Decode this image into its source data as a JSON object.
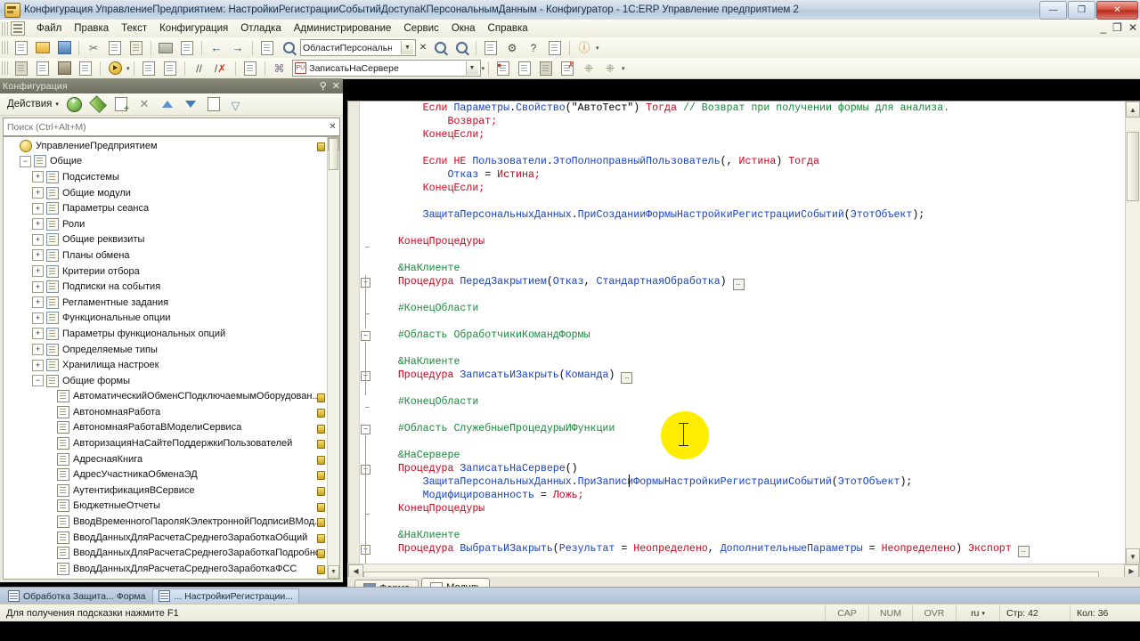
{
  "window": {
    "title": "Конфигурация УправлениеПредприятием: НастройкиРегистрацииСобытийДоступаКПерсональнымДанным - Конфигуратор - 1C:ERP Управление предприятием 2",
    "minimize": "—",
    "restore": "❐",
    "close": "✕",
    "inner_minimize": "_",
    "inner_restore": "❐",
    "inner_close": "✕"
  },
  "menu": {
    "items": [
      {
        "label": "Файл"
      },
      {
        "label": "Правка"
      },
      {
        "label": "Текст"
      },
      {
        "label": "Конфигурация"
      },
      {
        "label": "Отладка"
      },
      {
        "label": "Администрирование"
      },
      {
        "label": "Сервис"
      },
      {
        "label": "Окна"
      },
      {
        "label": "Справка"
      }
    ]
  },
  "toolbar_main": {
    "combo_value": "ОбластиПерсональныхДанных",
    "clear_label": "✕",
    "arrow_label": "▼"
  },
  "toolbar_second": {
    "proc_badge": "PU",
    "proc_value": "ЗаписатьНаСервере",
    "arrow_label": "▼"
  },
  "left_panel": {
    "caption": "Конфигурация",
    "pin_icon": "⚲",
    "close_icon": "✕",
    "actions_label": "Действия",
    "actions_caret": "▾",
    "search_placeholder": "Поиск (Ctrl+Alt+M)",
    "search_value": "",
    "search_clear": "✕",
    "tree": [
      {
        "label": "УправлениеПредприятием",
        "indent": 0,
        "expander": "",
        "icon": "yellow-ball-icon",
        "dot": true
      },
      {
        "label": "Общие",
        "indent": 1,
        "expander": "−",
        "icon": "common-icon",
        "dot": false
      },
      {
        "label": "Подсистемы",
        "indent": 2,
        "expander": "+",
        "icon": "subsystems-icon",
        "dot": false
      },
      {
        "label": "Общие модули",
        "indent": 2,
        "expander": "+",
        "icon": "module-icon",
        "dot": false
      },
      {
        "label": "Параметры сеанса",
        "indent": 2,
        "expander": "+",
        "icon": "diamond-icon",
        "dot": false
      },
      {
        "label": "Роли",
        "indent": 2,
        "expander": "+",
        "icon": "key-icon",
        "dot": false
      },
      {
        "label": "Общие реквизиты",
        "indent": 2,
        "expander": "+",
        "icon": "attribute-icon",
        "dot": false
      },
      {
        "label": "Планы обмена",
        "indent": 2,
        "expander": "+",
        "icon": "exchange-icon",
        "dot": false
      },
      {
        "label": "Критерии отбора",
        "indent": 2,
        "expander": "+",
        "icon": "filter-icon",
        "dot": false
      },
      {
        "label": "Подписки на события",
        "indent": 2,
        "expander": "+",
        "icon": "subscription-icon",
        "dot": false
      },
      {
        "label": "Регламентные задания",
        "indent": 2,
        "expander": "+",
        "icon": "clock-icon",
        "dot": false
      },
      {
        "label": "Функциональные опции",
        "indent": 2,
        "expander": "+",
        "icon": "options-icon",
        "dot": false
      },
      {
        "label": "Параметры функциональных опций",
        "indent": 2,
        "expander": "+",
        "icon": "option-params-icon",
        "dot": false
      },
      {
        "label": "Определяемые типы",
        "indent": 2,
        "expander": "+",
        "icon": "types-icon",
        "dot": false
      },
      {
        "label": "Хранилища настроек",
        "indent": 2,
        "expander": "+",
        "icon": "storage-icon",
        "dot": false
      },
      {
        "label": "Общие формы",
        "indent": 2,
        "expander": "−",
        "icon": "form-icon",
        "dot": false
      },
      {
        "label": "АвтоматическийОбменСПодключаемымОборудован...",
        "indent": 3,
        "expander": "",
        "icon": "form-icon",
        "dot": true
      },
      {
        "label": "АвтономнаяРабота",
        "indent": 3,
        "expander": "",
        "icon": "form-icon",
        "dot": true
      },
      {
        "label": "АвтономнаяРаботаВМоделиСервиса",
        "indent": 3,
        "expander": "",
        "icon": "form-icon",
        "dot": true
      },
      {
        "label": "АвторизацияНаСайтеПоддержкиПользователей",
        "indent": 3,
        "expander": "",
        "icon": "form-icon",
        "dot": true
      },
      {
        "label": "АдреснаяКнига",
        "indent": 3,
        "expander": "",
        "icon": "form-icon",
        "dot": true
      },
      {
        "label": "АдресУчастникаОбменаЭД",
        "indent": 3,
        "expander": "",
        "icon": "form-icon",
        "dot": true
      },
      {
        "label": "АутентификацияВСервисе",
        "indent": 3,
        "expander": "",
        "icon": "form-icon",
        "dot": true
      },
      {
        "label": "БюджетныеОтчеты",
        "indent": 3,
        "expander": "",
        "icon": "form-icon",
        "dot": true
      },
      {
        "label": "ВводВременногоПароляКЭлектроннойПодписиВМод...",
        "indent": 3,
        "expander": "",
        "icon": "form-icon",
        "dot": true
      },
      {
        "label": "ВводДанныхДляРасчетаСреднегоЗаработкаОбщий",
        "indent": 3,
        "expander": "",
        "icon": "form-icon",
        "dot": true
      },
      {
        "label": "ВводДанныхДляРасчетаСреднегоЗаработкаПодробно",
        "indent": 3,
        "expander": "",
        "icon": "form-icon",
        "dot": true
      },
      {
        "label": "ВводДанныхДляРасчетаСреднегоЗаработкаФСС",
        "indent": 3,
        "expander": "",
        "icon": "form-icon",
        "dot": true
      }
    ]
  },
  "editor": {
    "lines": [
      {
        "fold": "",
        "tokens": [
          {
            "t": "        ",
            "c": "pl"
          },
          {
            "t": "Если ",
            "c": "kw"
          },
          {
            "t": "Параметры",
            "c": "id"
          },
          {
            "t": ".",
            "c": "pl"
          },
          {
            "t": "Свойство",
            "c": "id"
          },
          {
            "t": "(\"АвтоТест\") ",
            "c": "pl"
          },
          {
            "t": "Тогда ",
            "c": "kw"
          },
          {
            "t": "// Возврат при получении формы для анализа.",
            "c": "cm"
          }
        ]
      },
      {
        "fold": "",
        "tokens": [
          {
            "t": "            ",
            "c": "pl"
          },
          {
            "t": "Возврат;",
            "c": "kw"
          }
        ]
      },
      {
        "fold": "",
        "tokens": [
          {
            "t": "        ",
            "c": "pl"
          },
          {
            "t": "КонецЕсли;",
            "c": "kw"
          }
        ]
      },
      {
        "fold": "",
        "tokens": [
          {
            "t": "",
            "c": "pl"
          }
        ]
      },
      {
        "fold": "",
        "tokens": [
          {
            "t": "        ",
            "c": "pl"
          },
          {
            "t": "Если НЕ ",
            "c": "kw"
          },
          {
            "t": "Пользователи",
            "c": "id"
          },
          {
            "t": ".",
            "c": "pl"
          },
          {
            "t": "ЭтоПолноправныйПользователь",
            "c": "id"
          },
          {
            "t": "(, ",
            "c": "pl"
          },
          {
            "t": "Истина",
            "c": "kw"
          },
          {
            "t": ") ",
            "c": "pl"
          },
          {
            "t": "Тогда",
            "c": "kw"
          }
        ]
      },
      {
        "fold": "",
        "tokens": [
          {
            "t": "            ",
            "c": "pl"
          },
          {
            "t": "Отказ",
            "c": "id"
          },
          {
            "t": " = ",
            "c": "pl"
          },
          {
            "t": "Истина;",
            "c": "kw"
          }
        ]
      },
      {
        "fold": "",
        "tokens": [
          {
            "t": "        ",
            "c": "pl"
          },
          {
            "t": "КонецЕсли;",
            "c": "kw"
          }
        ]
      },
      {
        "fold": "",
        "tokens": [
          {
            "t": "",
            "c": "pl"
          }
        ]
      },
      {
        "fold": "",
        "tokens": [
          {
            "t": "        ",
            "c": "pl"
          },
          {
            "t": "ЗащитаПерсональныхДанных",
            "c": "id"
          },
          {
            "t": ".",
            "c": "pl"
          },
          {
            "t": "ПриСозданииФормыНастройкиРегистрацииСобытий",
            "c": "id"
          },
          {
            "t": "(",
            "c": "pl"
          },
          {
            "t": "ЭтотОбъект",
            "c": "id"
          },
          {
            "t": ");",
            "c": "pl"
          }
        ]
      },
      {
        "fold": "",
        "tokens": [
          {
            "t": "",
            "c": "pl"
          }
        ]
      },
      {
        "fold": "endtick",
        "tokens": [
          {
            "t": "    ",
            "c": "pl"
          },
          {
            "t": "КонецПроцедуры",
            "c": "kw"
          }
        ]
      },
      {
        "fold": "",
        "tokens": [
          {
            "t": "",
            "c": "pl"
          }
        ]
      },
      {
        "fold": "",
        "tokens": [
          {
            "t": "    ",
            "c": "pl"
          },
          {
            "t": "&НаКлиенте",
            "c": "cm"
          }
        ]
      },
      {
        "fold": "plus",
        "tokens": [
          {
            "t": "    ",
            "c": "pl"
          },
          {
            "t": "Процедура ",
            "c": "kw"
          },
          {
            "t": "ПередЗакрытием",
            "c": "id"
          },
          {
            "t": "(",
            "c": "pl"
          },
          {
            "t": "Отказ",
            "c": "id"
          },
          {
            "t": ", ",
            "c": "pl"
          },
          {
            "t": "СтандартнаяОбработка",
            "c": "id"
          },
          {
            "t": ") ",
            "c": "pl"
          },
          {
            "t": "[…]",
            "c": "ellip"
          }
        ]
      },
      {
        "fold": "",
        "tokens": [
          {
            "t": "",
            "c": "pl"
          }
        ]
      },
      {
        "fold": "endtick",
        "tokens": [
          {
            "t": "    ",
            "c": "pl"
          },
          {
            "t": "#КонецОбласти",
            "c": "cm"
          }
        ]
      },
      {
        "fold": "",
        "tokens": [
          {
            "t": "",
            "c": "pl"
          }
        ]
      },
      {
        "fold": "minus",
        "tokens": [
          {
            "t": "    ",
            "c": "pl"
          },
          {
            "t": "#Область ОбработчикиКомандФормы",
            "c": "cm"
          }
        ]
      },
      {
        "fold": "",
        "tokens": [
          {
            "t": "",
            "c": "pl"
          }
        ]
      },
      {
        "fold": "",
        "tokens": [
          {
            "t": "    ",
            "c": "pl"
          },
          {
            "t": "&НаКлиенте",
            "c": "cm"
          }
        ]
      },
      {
        "fold": "plus",
        "tokens": [
          {
            "t": "    ",
            "c": "pl"
          },
          {
            "t": "Процедура ",
            "c": "kw"
          },
          {
            "t": "ЗаписатьИЗакрыть",
            "c": "id"
          },
          {
            "t": "(",
            "c": "pl"
          },
          {
            "t": "Команда",
            "c": "id"
          },
          {
            "t": ") ",
            "c": "pl"
          },
          {
            "t": "[…]",
            "c": "ellip"
          }
        ]
      },
      {
        "fold": "",
        "tokens": [
          {
            "t": "",
            "c": "pl"
          }
        ]
      },
      {
        "fold": "endtick",
        "tokens": [
          {
            "t": "    ",
            "c": "pl"
          },
          {
            "t": "#КонецОбласти",
            "c": "cm"
          }
        ]
      },
      {
        "fold": "",
        "tokens": [
          {
            "t": "",
            "c": "pl"
          }
        ]
      },
      {
        "fold": "minus",
        "tokens": [
          {
            "t": "    ",
            "c": "pl"
          },
          {
            "t": "#Область СлужебныеПроцедурыИФункции",
            "c": "cm"
          }
        ]
      },
      {
        "fold": "",
        "tokens": [
          {
            "t": "",
            "c": "pl"
          }
        ]
      },
      {
        "fold": "",
        "tokens": [
          {
            "t": "    ",
            "c": "pl"
          },
          {
            "t": "&НаСервере",
            "c": "cm"
          }
        ]
      },
      {
        "fold": "minus",
        "tokens": [
          {
            "t": "    ",
            "c": "pl"
          },
          {
            "t": "Процедура ",
            "c": "kw"
          },
          {
            "t": "ЗаписатьНаСервере",
            "c": "id"
          },
          {
            "t": "()",
            "c": "pl"
          }
        ]
      },
      {
        "fold": "",
        "tokens": [
          {
            "t": "        ",
            "c": "pl"
          },
          {
            "t": "ЗащитаПерсональныхДанных",
            "c": "id"
          },
          {
            "t": ".",
            "c": "pl"
          },
          {
            "t": "ПриЗаписиФормыНастройкиРегистрацииСобытий",
            "c": "id"
          },
          {
            "t": "(",
            "c": "pl"
          },
          {
            "t": "ЭтотОбъект",
            "c": "id"
          },
          {
            "t": ");",
            "c": "pl"
          }
        ]
      },
      {
        "fold": "",
        "tokens": [
          {
            "t": "        ",
            "c": "pl"
          },
          {
            "t": "Модифицированность",
            "c": "id"
          },
          {
            "t": " = ",
            "c": "pl"
          },
          {
            "t": "Ложь;",
            "c": "kw"
          }
        ]
      },
      {
        "fold": "endtick",
        "tokens": [
          {
            "t": "    ",
            "c": "pl"
          },
          {
            "t": "КонецПроцедуры",
            "c": "kw"
          }
        ]
      },
      {
        "fold": "",
        "tokens": [
          {
            "t": "",
            "c": "pl"
          }
        ]
      },
      {
        "fold": "",
        "tokens": [
          {
            "t": "    ",
            "c": "pl"
          },
          {
            "t": "&НаКлиенте",
            "c": "cm"
          }
        ]
      },
      {
        "fold": "plus",
        "tokens": [
          {
            "t": "    ",
            "c": "pl"
          },
          {
            "t": "Процедура ",
            "c": "kw"
          },
          {
            "t": "ВыбратьИЗакрыть",
            "c": "id"
          },
          {
            "t": "(",
            "c": "pl"
          },
          {
            "t": "Результат",
            "c": "id"
          },
          {
            "t": " = ",
            "c": "pl"
          },
          {
            "t": "Неопределено",
            "c": "kw"
          },
          {
            "t": ", ",
            "c": "pl"
          },
          {
            "t": "ДополнительныеПараметры",
            "c": "id"
          },
          {
            "t": " = ",
            "c": "pl"
          },
          {
            "t": "Неопределено",
            "c": "kw"
          },
          {
            "t": ") ",
            "c": "pl"
          },
          {
            "t": "Экспорт ",
            "c": "kw"
          },
          {
            "t": "[…]",
            "c": "ellip"
          }
        ]
      }
    ]
  },
  "bottom_tabs": [
    {
      "label": "Форма",
      "active": false,
      "icon": "form-tab-icon"
    },
    {
      "label": "Модуль",
      "active": true,
      "icon": "module-tab-icon"
    }
  ],
  "taskbar": [
    {
      "label": "Обработка Защита...  Форма",
      "selected": false,
      "icon": "window-icon"
    },
    {
      "label": "... НастройкиРегистрации...",
      "selected": true,
      "icon": "window-icon"
    }
  ],
  "status": {
    "hint": "Для получения подсказки нажмите F1",
    "cap": "CAP",
    "num": "NUM",
    "ovr": "OVR",
    "lang": "ru",
    "lang_caret": "▾",
    "line": "Стр: 42",
    "col": "Кол: 36"
  }
}
